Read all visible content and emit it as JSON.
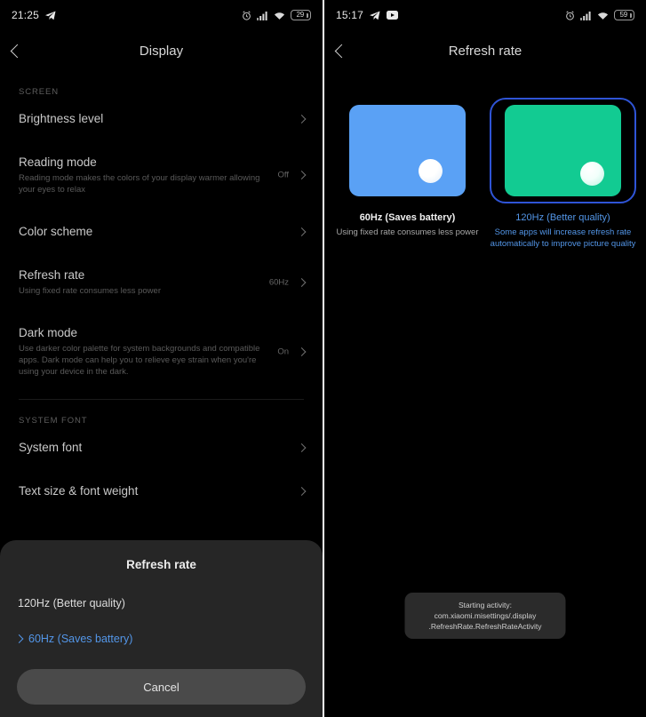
{
  "left": {
    "status_bar": {
      "time": "21:25",
      "icons": [
        "telegram-icon",
        "alarm-icon",
        "signal-icon",
        "wifi-icon"
      ],
      "battery_percent": "29"
    },
    "appbar": {
      "title": "Display",
      "back": "back-arrow"
    },
    "sections": [
      {
        "label": "SCREEN",
        "rows": [
          {
            "title": "Brightness level",
            "sub": "",
            "value": ""
          },
          {
            "title": "Reading mode",
            "sub": "Reading mode makes the colors of your display warmer allowing your eyes to relax",
            "value": "Off"
          },
          {
            "title": "Color scheme",
            "sub": "",
            "value": ""
          },
          {
            "title": "Refresh rate",
            "sub": "Using fixed rate consumes less power",
            "value": "60Hz"
          },
          {
            "title": "Dark mode",
            "sub": "Use darker color palette for system backgrounds and compatible apps. Dark mode can help you to relieve eye strain when you're using your device in the dark.",
            "value": "On"
          }
        ]
      },
      {
        "label": "SYSTEM FONT",
        "rows": [
          {
            "title": "System font",
            "sub": "",
            "value": ""
          },
          {
            "title": "Text size & font weight",
            "sub": "",
            "value": ""
          }
        ]
      }
    ],
    "sheet": {
      "title": "Refresh rate",
      "options": [
        {
          "label": "120Hz (Better quality)",
          "selected": false
        },
        {
          "label": "60Hz (Saves battery)",
          "selected": true
        }
      ],
      "cancel_label": "Cancel"
    }
  },
  "right": {
    "status_bar": {
      "time": "15:17",
      "icons": [
        "telegram-icon",
        "youtube-icon",
        "alarm-icon",
        "signal-icon",
        "wifi-icon"
      ],
      "battery_percent": "59"
    },
    "appbar": {
      "title": "Refresh rate",
      "back": "back-arrow"
    },
    "options": [
      {
        "label": "60Hz (Saves battery)",
        "desc": "Using fixed rate consumes less power",
        "selected": false,
        "thumb_color": "#5aa1f5"
      },
      {
        "label": "120Hz (Better quality)",
        "desc": "Some apps will increase refresh rate automatically to improve picture quality",
        "selected": true,
        "thumb_color": "#12cb92"
      }
    ],
    "toast": "Starting activity: com.xiaomi.misettings/.display .RefreshRate.RefreshRateActivity"
  },
  "colors": {
    "accent": "#5396e8",
    "selection_ring": "#2f54d6",
    "sheet_bg": "#262626"
  }
}
